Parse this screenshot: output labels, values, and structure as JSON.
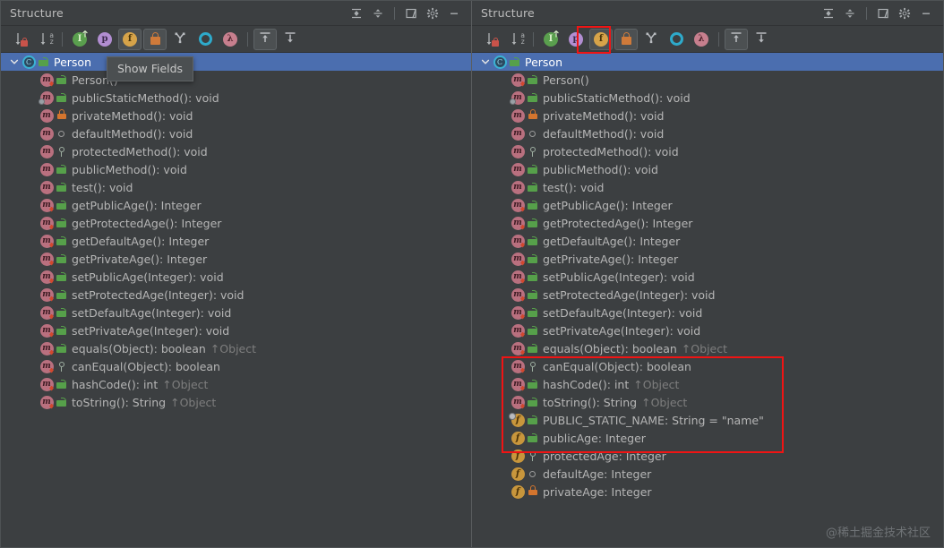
{
  "panels": [
    {
      "id": "left",
      "header": {
        "title": "Structure",
        "buttons": [
          {
            "name": "expand-all-icon",
            "label": "Expand All"
          },
          {
            "name": "collapse-all-icon",
            "label": "Collapse All"
          },
          {
            "name": "window-layout-icon",
            "label": "Settings Layout"
          },
          {
            "name": "gear-icon",
            "label": "Settings"
          },
          {
            "name": "minimize-icon",
            "label": "Hide"
          }
        ]
      },
      "toolbar": [
        {
          "name": "sort-by-visibility-button",
          "label": "Sort by Visibility",
          "glyph": "sort-vis",
          "active": false
        },
        {
          "name": "sort-alphabetically-button",
          "label": "Sort Alphabetically",
          "glyph": "sort-az",
          "active": false
        },
        {
          "name": "show-inherited-button",
          "label": "Show Inherited",
          "glyph": "inherited",
          "active": false
        },
        {
          "name": "show-properties-button",
          "label": "Show Properties",
          "glyph": "properties",
          "active": false
        },
        {
          "name": "show-fields-button",
          "label": "Show Fields",
          "glyph": "fields",
          "active": true
        },
        {
          "name": "show-non-public-button",
          "label": "Show Non-Public",
          "glyph": "nonpublic",
          "active": true
        },
        {
          "name": "show-anonymous-classes-button",
          "label": "Show Anonymous Classes",
          "glyph": "anonymous",
          "active": false
        },
        {
          "name": "group-by-type-button",
          "label": "Group Methods by Defining Type",
          "glyph": "ring",
          "active": false
        },
        {
          "name": "show-lambdas-button",
          "label": "Show Lambdas",
          "glyph": "lambda",
          "active": false
        },
        {
          "name": "autoscroll-to-source-button",
          "label": "Autoscroll to Source",
          "glyph": "scroll-from",
          "active": true
        },
        {
          "name": "autoscroll-from-source-button",
          "label": "Autoscroll from Source",
          "glyph": "scroll-to",
          "active": false
        }
      ],
      "tooltip": {
        "visible": true,
        "text": "Show Fields"
      },
      "tree": [
        {
          "depth": 0,
          "kind": "class",
          "modifier": "public",
          "label": "Person",
          "selected": true,
          "expandable": true
        },
        {
          "depth": 1,
          "kind": "constructor",
          "modifier": "public",
          "label": "Person()",
          "selected": false
        },
        {
          "depth": 1,
          "kind": "method-static",
          "modifier": "public",
          "label": "publicStaticMethod(): void",
          "selected": false
        },
        {
          "depth": 1,
          "kind": "method",
          "modifier": "private",
          "label": "privateMethod(): void",
          "selected": false
        },
        {
          "depth": 1,
          "kind": "method",
          "modifier": "default",
          "label": "defaultMethod(): void",
          "selected": false
        },
        {
          "depth": 1,
          "kind": "method",
          "modifier": "protected",
          "label": "protectedMethod(): void",
          "selected": false
        },
        {
          "depth": 1,
          "kind": "method",
          "modifier": "public",
          "label": "publicMethod(): void",
          "selected": false
        },
        {
          "depth": 1,
          "kind": "method",
          "modifier": "public",
          "label": "test(): void",
          "selected": false
        },
        {
          "depth": 1,
          "kind": "constructor",
          "modifier": "public",
          "label": "getPublicAge(): Integer",
          "selected": false
        },
        {
          "depth": 1,
          "kind": "constructor",
          "modifier": "public",
          "label": "getProtectedAge(): Integer",
          "selected": false
        },
        {
          "depth": 1,
          "kind": "constructor",
          "modifier": "public",
          "label": "getDefaultAge(): Integer",
          "selected": false
        },
        {
          "depth": 1,
          "kind": "constructor",
          "modifier": "public",
          "label": "getPrivateAge(): Integer",
          "selected": false
        },
        {
          "depth": 1,
          "kind": "constructor",
          "modifier": "public",
          "label": "setPublicAge(Integer): void",
          "selected": false
        },
        {
          "depth": 1,
          "kind": "constructor",
          "modifier": "public",
          "label": "setProtectedAge(Integer): void",
          "selected": false
        },
        {
          "depth": 1,
          "kind": "constructor",
          "modifier": "public",
          "label": "setDefaultAge(Integer): void",
          "selected": false
        },
        {
          "depth": 1,
          "kind": "constructor",
          "modifier": "public",
          "label": "setPrivateAge(Integer): void",
          "selected": false
        },
        {
          "depth": 1,
          "kind": "constructor",
          "modifier": "public",
          "label": "equals(Object): boolean",
          "inherited": "↑Object",
          "selected": false
        },
        {
          "depth": 1,
          "kind": "constructor",
          "modifier": "protected",
          "label": "canEqual(Object): boolean",
          "selected": false
        },
        {
          "depth": 1,
          "kind": "constructor",
          "modifier": "public",
          "label": "hashCode(): int",
          "inherited": "↑Object",
          "selected": false
        },
        {
          "depth": 1,
          "kind": "constructor",
          "modifier": "public",
          "label": "toString(): String",
          "inherited": "↑Object",
          "selected": false
        }
      ]
    },
    {
      "id": "right",
      "header": {
        "title": "Structure",
        "buttons": [
          {
            "name": "expand-all-icon",
            "label": "Expand All"
          },
          {
            "name": "collapse-all-icon",
            "label": "Collapse All"
          },
          {
            "name": "window-layout-icon",
            "label": "Settings Layout"
          },
          {
            "name": "gear-icon",
            "label": "Settings"
          },
          {
            "name": "minimize-icon",
            "label": "Hide"
          }
        ]
      },
      "toolbar": [
        {
          "name": "sort-by-visibility-button",
          "label": "Sort by Visibility",
          "glyph": "sort-vis",
          "active": false
        },
        {
          "name": "sort-alphabetically-button",
          "label": "Sort Alphabetically",
          "glyph": "sort-az",
          "active": false
        },
        {
          "name": "show-inherited-button",
          "label": "Show Inherited",
          "glyph": "inherited",
          "active": false
        },
        {
          "name": "show-properties-button",
          "label": "Show Properties",
          "glyph": "properties",
          "active": false
        },
        {
          "name": "show-fields-button",
          "label": "Show Fields",
          "glyph": "fields",
          "active": true,
          "highlighted": true
        },
        {
          "name": "show-non-public-button",
          "label": "Show Non-Public",
          "glyph": "nonpublic",
          "active": true
        },
        {
          "name": "show-anonymous-classes-button",
          "label": "Show Anonymous Classes",
          "glyph": "anonymous",
          "active": false
        },
        {
          "name": "group-by-type-button",
          "label": "Group Methods by Defining Type",
          "glyph": "ring",
          "active": false
        },
        {
          "name": "show-lambdas-button",
          "label": "Show Lambdas",
          "glyph": "lambda",
          "active": false
        },
        {
          "name": "autoscroll-to-source-button",
          "label": "Autoscroll to Source",
          "glyph": "scroll-from",
          "active": true
        },
        {
          "name": "autoscroll-from-source-button",
          "label": "Autoscroll from Source",
          "glyph": "scroll-to",
          "active": false
        }
      ],
      "tooltip": {
        "visible": false,
        "text": ""
      },
      "tree": [
        {
          "depth": 0,
          "kind": "class",
          "modifier": "public",
          "label": "Person",
          "selected": true,
          "expandable": true
        },
        {
          "depth": 1,
          "kind": "constructor",
          "modifier": "public",
          "label": "Person()",
          "selected": false
        },
        {
          "depth": 1,
          "kind": "method-static",
          "modifier": "public",
          "label": "publicStaticMethod(): void",
          "selected": false
        },
        {
          "depth": 1,
          "kind": "method",
          "modifier": "private",
          "label": "privateMethod(): void",
          "selected": false
        },
        {
          "depth": 1,
          "kind": "method",
          "modifier": "default",
          "label": "defaultMethod(): void",
          "selected": false
        },
        {
          "depth": 1,
          "kind": "method",
          "modifier": "protected",
          "label": "protectedMethod(): void",
          "selected": false
        },
        {
          "depth": 1,
          "kind": "method",
          "modifier": "public",
          "label": "publicMethod(): void",
          "selected": false
        },
        {
          "depth": 1,
          "kind": "method",
          "modifier": "public",
          "label": "test(): void",
          "selected": false
        },
        {
          "depth": 1,
          "kind": "constructor",
          "modifier": "public",
          "label": "getPublicAge(): Integer",
          "selected": false
        },
        {
          "depth": 1,
          "kind": "constructor",
          "modifier": "public",
          "label": "getProtectedAge(): Integer",
          "selected": false
        },
        {
          "depth": 1,
          "kind": "constructor",
          "modifier": "public",
          "label": "getDefaultAge(): Integer",
          "selected": false
        },
        {
          "depth": 1,
          "kind": "constructor",
          "modifier": "public",
          "label": "getPrivateAge(): Integer",
          "selected": false
        },
        {
          "depth": 1,
          "kind": "constructor",
          "modifier": "public",
          "label": "setPublicAge(Integer): void",
          "selected": false
        },
        {
          "depth": 1,
          "kind": "constructor",
          "modifier": "public",
          "label": "setProtectedAge(Integer): void",
          "selected": false
        },
        {
          "depth": 1,
          "kind": "constructor",
          "modifier": "public",
          "label": "setDefaultAge(Integer): void",
          "selected": false
        },
        {
          "depth": 1,
          "kind": "constructor",
          "modifier": "public",
          "label": "setPrivateAge(Integer): void",
          "selected": false
        },
        {
          "depth": 1,
          "kind": "constructor",
          "modifier": "public",
          "label": "equals(Object): boolean",
          "inherited": "↑Object",
          "selected": false
        },
        {
          "depth": 1,
          "kind": "constructor",
          "modifier": "protected",
          "label": "canEqual(Object): boolean",
          "selected": false
        },
        {
          "depth": 1,
          "kind": "constructor",
          "modifier": "public",
          "label": "hashCode(): int",
          "inherited": "↑Object",
          "selected": false
        },
        {
          "depth": 1,
          "kind": "constructor",
          "modifier": "public",
          "label": "toString(): String",
          "inherited": "↑Object",
          "selected": false
        },
        {
          "depth": 1,
          "kind": "field-static",
          "modifier": "public",
          "label": "PUBLIC_STATIC_NAME: String = \"name\"",
          "selected": false
        },
        {
          "depth": 1,
          "kind": "field",
          "modifier": "public",
          "label": "publicAge: Integer",
          "selected": false
        },
        {
          "depth": 1,
          "kind": "field",
          "modifier": "protected",
          "label": "protectedAge: Integer",
          "selected": false
        },
        {
          "depth": 1,
          "kind": "field",
          "modifier": "default",
          "label": "defaultAge: Integer",
          "selected": false
        },
        {
          "depth": 1,
          "kind": "field",
          "modifier": "private",
          "label": "privateAge: Integer",
          "selected": false
        }
      ]
    }
  ],
  "annotations": {
    "toolbar_highlight": {
      "name": "show-fields-button-highlight"
    },
    "fields_highlight": {
      "name": "fields-group-highlight"
    },
    "color": "#f01414"
  },
  "watermark": {
    "text": "@稀土掘金技术社区"
  },
  "colors": {
    "background": "#3c3f41",
    "selection": "#4b6eaf",
    "text": "#b6b6b6",
    "inherited_text": "#7e7e7e",
    "annotation_red": "#f01414",
    "field_icon": "#c8963c",
    "method_icon": "#b9707f",
    "class_icon": "#3bb3d4"
  }
}
